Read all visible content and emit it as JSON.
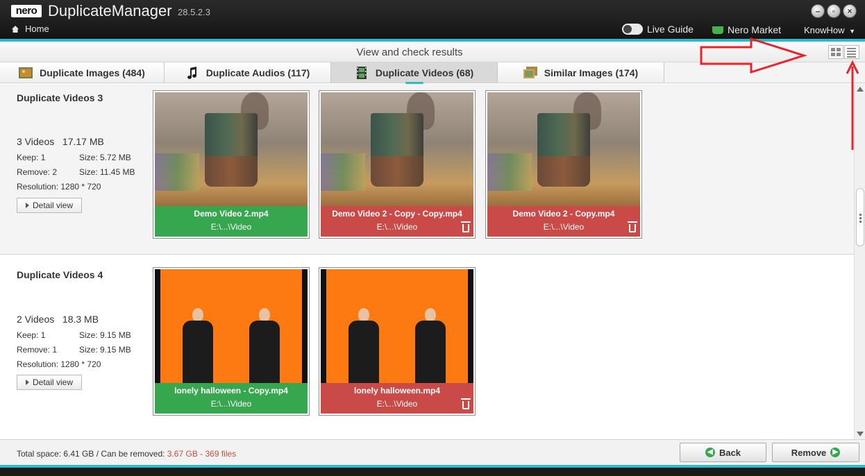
{
  "app": {
    "logo": "nero",
    "name": "DuplicateManager",
    "version": "28.5.2.3",
    "home": "Home",
    "live_guide": "Live Guide",
    "market": "Nero Market",
    "knowhow": "KnowHow",
    "window_buttons": [
      "minimize-icon",
      "restore-icon",
      "close-icon"
    ]
  },
  "view": {
    "title": "View and check results",
    "toggle_icons": [
      "grid-view-icon",
      "list-view-icon"
    ]
  },
  "tabs": [
    {
      "label": "Duplicate Images (484)",
      "icon": "images-icon",
      "active": false
    },
    {
      "label": "Duplicate Audios (117)",
      "icon": "music-note-icon",
      "active": false
    },
    {
      "label": "Duplicate Videos (68)",
      "icon": "film-icon",
      "active": true
    },
    {
      "label": "Similar Images (174)",
      "icon": "similar-images-icon",
      "active": false
    }
  ],
  "groups": [
    {
      "title": "Duplicate Videos 3",
      "count": "3 Videos",
      "total_size": "17.17 MB",
      "keep": "Keep: 1",
      "keep_size": "Size: 5.72 MB",
      "remove": "Remove: 2",
      "remove_size": "Size: 11.45 MB",
      "resolution": "Resolution: 1280 * 720",
      "detail_label": "Detail view",
      "files": [
        {
          "name": "Demo Video 2.mp4",
          "path": "E:\\...\\Video",
          "status": "keep"
        },
        {
          "name": "Demo Video 2 - Copy - Copy.mp4",
          "path": "E:\\...\\Video",
          "status": "remove"
        },
        {
          "name": "Demo Video 2 - Copy.mp4",
          "path": "E:\\...\\Video",
          "status": "remove"
        }
      ]
    },
    {
      "title": "Duplicate Videos 4",
      "count": "2 Videos",
      "total_size": "18.3 MB",
      "keep": "Keep: 1",
      "keep_size": "Size: 9.15 MB",
      "remove": "Remove: 1",
      "remove_size": "Size: 9.15 MB",
      "resolution": "Resolution: 1280 * 720",
      "detail_label": "Detail view",
      "files": [
        {
          "name": "lonely halloween - Copy.mp4",
          "path": "E:\\...\\Video",
          "status": "keep"
        },
        {
          "name": "lonely halloween.mp4",
          "path": "E:\\...\\Video",
          "status": "remove"
        }
      ]
    }
  ],
  "footer": {
    "status_prefix": "Total space: 6.41 GB / Can be removed: ",
    "status_removable": "3.67 GB - 369 files",
    "back_label": "Back",
    "remove_label": "Remove"
  },
  "colors": {
    "keep": "#37a74f",
    "remove": "#c94a46",
    "accent": "#2bbcc8",
    "annotation": "#e8232a"
  }
}
